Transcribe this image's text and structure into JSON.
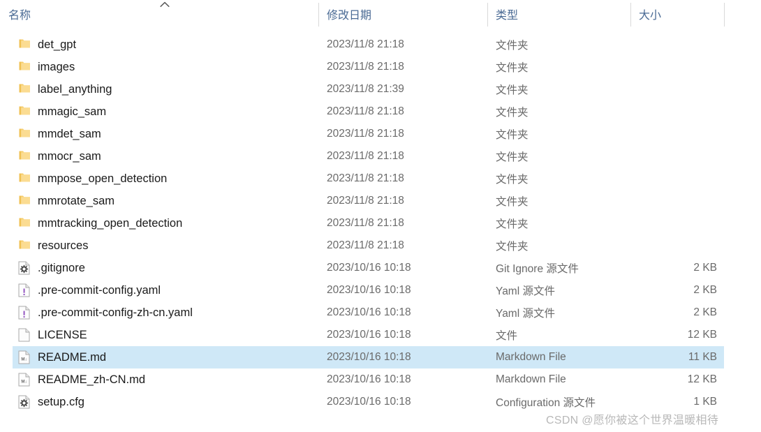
{
  "window": {
    "type": "file-explorer-list-view",
    "accent_selection_color": "#cfe8f7",
    "header_text_color": "#4a6a94",
    "folder_icon_color": "#f5c95c"
  },
  "columns": {
    "name": {
      "label": "名称",
      "sorted": "ascending",
      "sort_icon": "chevron-up-icon"
    },
    "date": {
      "label": "修改日期"
    },
    "type": {
      "label": "类型"
    },
    "size": {
      "label": "大小"
    }
  },
  "rows": [
    {
      "name": "det_gpt",
      "date": "2023/11/8 21:18",
      "type": "文件夹",
      "size": "",
      "icon": "folder-icon",
      "selected": false
    },
    {
      "name": "images",
      "date": "2023/11/8 21:18",
      "type": "文件夹",
      "size": "",
      "icon": "folder-icon",
      "selected": false
    },
    {
      "name": "label_anything",
      "date": "2023/11/8 21:39",
      "type": "文件夹",
      "size": "",
      "icon": "folder-icon",
      "selected": false
    },
    {
      "name": "mmagic_sam",
      "date": "2023/11/8 21:18",
      "type": "文件夹",
      "size": "",
      "icon": "folder-icon",
      "selected": false
    },
    {
      "name": "mmdet_sam",
      "date": "2023/11/8 21:18",
      "type": "文件夹",
      "size": "",
      "icon": "folder-icon",
      "selected": false
    },
    {
      "name": "mmocr_sam",
      "date": "2023/11/8 21:18",
      "type": "文件夹",
      "size": "",
      "icon": "folder-icon",
      "selected": false
    },
    {
      "name": "mmpose_open_detection",
      "date": "2023/11/8 21:18",
      "type": "文件夹",
      "size": "",
      "icon": "folder-icon",
      "selected": false
    },
    {
      "name": "mmrotate_sam",
      "date": "2023/11/8 21:18",
      "type": "文件夹",
      "size": "",
      "icon": "folder-icon",
      "selected": false
    },
    {
      "name": "mmtracking_open_detection",
      "date": "2023/11/8 21:18",
      "type": "文件夹",
      "size": "",
      "icon": "folder-icon",
      "selected": false
    },
    {
      "name": "resources",
      "date": "2023/11/8 21:18",
      "type": "文件夹",
      "size": "",
      "icon": "folder-icon",
      "selected": false
    },
    {
      "name": ".gitignore",
      "date": "2023/10/16 10:18",
      "type": "Git Ignore 源文件",
      "size": "2 KB",
      "icon": "gear-file-icon",
      "selected": false
    },
    {
      "name": ".pre-commit-config.yaml",
      "date": "2023/10/16 10:18",
      "type": "Yaml 源文件",
      "size": "2 KB",
      "icon": "yaml-file-icon",
      "selected": false
    },
    {
      "name": ".pre-commit-config-zh-cn.yaml",
      "date": "2023/10/16 10:18",
      "type": "Yaml 源文件",
      "size": "2 KB",
      "icon": "yaml-file-icon",
      "selected": false
    },
    {
      "name": "LICENSE",
      "date": "2023/10/16 10:18",
      "type": "文件",
      "size": "12 KB",
      "icon": "blank-file-icon",
      "selected": false
    },
    {
      "name": "README.md",
      "date": "2023/10/16 10:18",
      "type": "Markdown File",
      "size": "11 KB",
      "icon": "markdown-file-icon",
      "selected": true
    },
    {
      "name": "README_zh-CN.md",
      "date": "2023/10/16 10:18",
      "type": "Markdown File",
      "size": "12 KB",
      "icon": "markdown-file-icon",
      "selected": false
    },
    {
      "name": "setup.cfg",
      "date": "2023/10/16 10:18",
      "type": "Configuration 源文件",
      "size": "1 KB",
      "icon": "gear-file-icon",
      "selected": false
    }
  ],
  "watermark": {
    "text": "CSDN @愿你被这个世界温暖相待"
  }
}
